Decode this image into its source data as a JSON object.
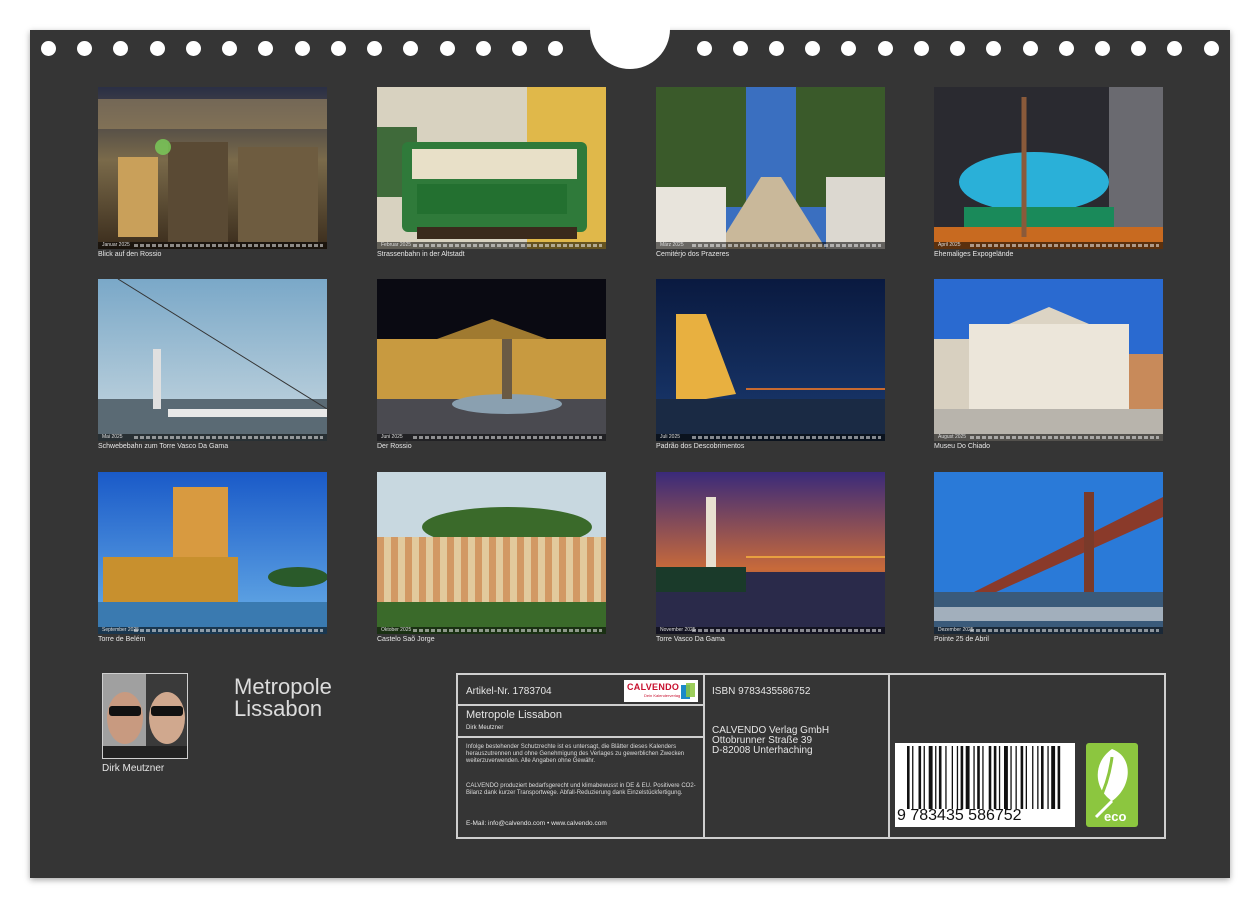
{
  "photos": [
    {
      "caption": "Blick auf den Rossio",
      "month": "Januar 2025"
    },
    {
      "caption": "Strassenbahn in der Altstadt",
      "month": "Februar 2025"
    },
    {
      "caption": "Cemitérjo dos Prazeres",
      "month": "März 2025"
    },
    {
      "caption": "Ehemaliges Expogelände",
      "month": "April 2025"
    },
    {
      "caption": "Schwebebahn zum Torre Vasco Da Gama",
      "month": "Mai 2025"
    },
    {
      "caption": "Der Rossio",
      "month": "Juni 2025"
    },
    {
      "caption": "Padrão dos Descobrimentos",
      "month": "Juli 2025"
    },
    {
      "caption": "Museu Do Chiado",
      "month": "August 2025"
    },
    {
      "caption": "Torre de Belém",
      "month": "September 2025"
    },
    {
      "caption": "Castelo Saõ Jorge",
      "month": "Oktober 2025"
    },
    {
      "caption": "Torre Vasco Da Gama",
      "month": "November 2025"
    },
    {
      "caption": "Pointe 25 de Abril",
      "month": "Dezember 2025"
    }
  ],
  "author": {
    "name": "Dirk Meutzner"
  },
  "title": {
    "line1": "Metropole",
    "line2": "Lissabon"
  },
  "info": {
    "article": "Artikel-Nr. 1783704",
    "publisher_logo": "CALVENDO",
    "publisher_tagline": "Dein Kalenderverlag",
    "product_title": "Metropole Lissabon",
    "product_author": "Dirk Meutzner",
    "legal_1": "Infolge bestehender Schutzrechte ist es untersagt, die Blätter dieses Kalenders herauszutrennen und ohne Genehmigung des Verlages zu gewerblichen Zwecken weiterzuverwenden. Alle Angaben ohne Gewähr.",
    "legal_2": "CALVENDO produziert bedarfsgerecht und klimabewusst in DE & EU. Positivere CO2-Bilanz dank kurzer Transportwege. Abfall-Reduzierung dank Einzelstückfertigung.",
    "contact": "E-Mail: info@calvendo.com • www.calvendo.com",
    "isbn": "ISBN 9783435586752",
    "publisher_name": "CALVENDO Verlag GmbH",
    "publisher_street": "Ottobrunner Straße 39",
    "publisher_city": "D-82008 Unterhaching",
    "barcode_digits": "9 783435 586752",
    "eco_label": "eco"
  },
  "colors": {
    "background": "#353535",
    "text": "#e6e6e6",
    "border": "#cfcfcf",
    "eco_green": "#8cc63f",
    "brand_red": "#c8102e"
  }
}
